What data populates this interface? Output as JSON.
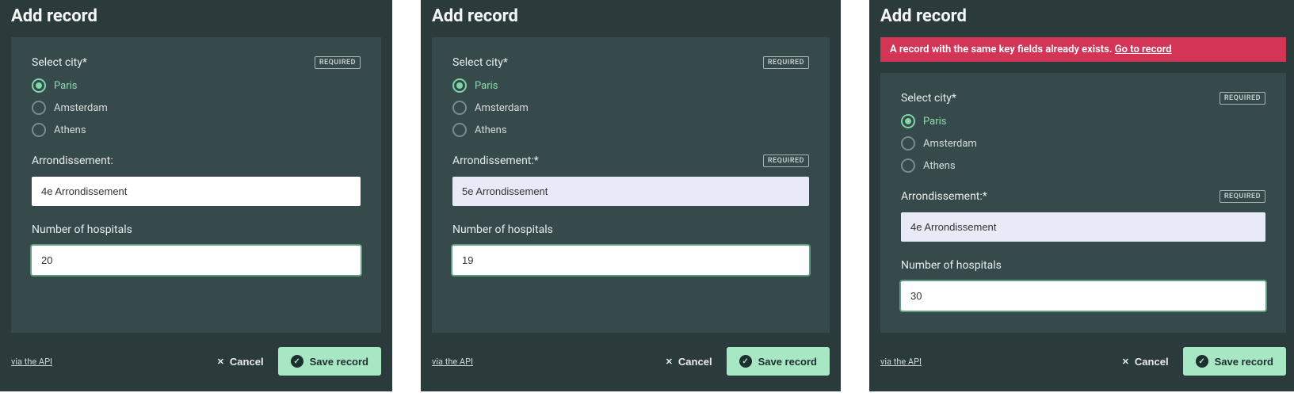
{
  "panels": [
    {
      "title": "Add record",
      "alert": null,
      "city_label": "Select city*",
      "city_required_badge": "REQUIRED",
      "city_options": [
        "Paris",
        "Amsterdam",
        "Athens"
      ],
      "city_selected": "Paris",
      "arr_label": "Arrondissement:",
      "arr_required_badge": null,
      "arr_value": "4e Arrondissement",
      "arr_style": "white",
      "hosp_label": "Number of hospitals",
      "hosp_value": "20",
      "api_link": "via the API",
      "cancel_label": "Cancel",
      "save_label": "Save record"
    },
    {
      "title": "Add record",
      "alert": null,
      "city_label": "Select city*",
      "city_required_badge": "REQUIRED",
      "city_options": [
        "Paris",
        "Amsterdam",
        "Athens"
      ],
      "city_selected": "Paris",
      "arr_label": "Arrondissement:*",
      "arr_required_badge": "REQUIRED",
      "arr_value": "5e Arrondissement",
      "arr_style": "lavender",
      "hosp_label": "Number of hospitals",
      "hosp_value": "19",
      "api_link": "via the API",
      "cancel_label": "Cancel",
      "save_label": "Save record"
    },
    {
      "title": "Add record",
      "alert": {
        "text": "A record with the same key fields already exists. ",
        "link_text": "Go to record"
      },
      "city_label": "Select city*",
      "city_required_badge": "REQUIRED",
      "city_options": [
        "Paris",
        "Amsterdam",
        "Athens"
      ],
      "city_selected": "Paris",
      "arr_label": "Arrondissement:*",
      "arr_required_badge": "REQUIRED",
      "arr_value": "4e Arrondissement",
      "arr_style": "lavender",
      "hosp_label": "Number of hospitals",
      "hosp_value": "30",
      "api_link": "via the API",
      "cancel_label": "Cancel",
      "save_label": "Save record"
    }
  ]
}
